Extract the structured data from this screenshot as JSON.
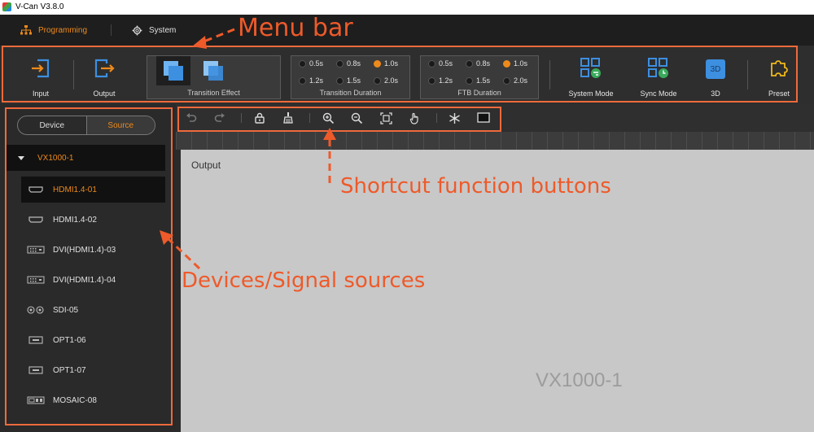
{
  "window": {
    "title": "V-Can V3.8.0"
  },
  "tabs": [
    {
      "label": "Programming",
      "icon": "sitemap-icon"
    },
    {
      "label": "System",
      "icon": "gear-icon"
    }
  ],
  "ribbon": {
    "input_label": "Input",
    "output_label": "Output",
    "transition_effect": {
      "label": "Transition Effect"
    },
    "transition_duration": {
      "label": "Transition Duration",
      "options": [
        "0.5s",
        "0.8s",
        "1.0s",
        "1.2s",
        "1.5s",
        "2.0s"
      ],
      "selected": "1.0s"
    },
    "ftb_duration": {
      "label": "FTB Duration",
      "options": [
        "0.5s",
        "0.8s",
        "1.0s",
        "1.2s",
        "1.5s",
        "2.0s"
      ],
      "selected": "1.0s"
    },
    "system_mode_label": "System Mode",
    "sync_mode_label": "Sync Mode",
    "threed_label": "3D",
    "threed_icon_text": "3D",
    "preset_label": "Preset"
  },
  "sidebar": {
    "segment": {
      "device": "Device",
      "source": "Source",
      "selected": "Source"
    },
    "device_name": "VX1000-1",
    "sources": [
      {
        "label": "HDMI1.4-01",
        "icon": "hdmi-port-icon",
        "selected": true
      },
      {
        "label": "HDMI1.4-02",
        "icon": "hdmi-port-icon",
        "selected": false
      },
      {
        "label": "DVI(HDMI1.4)-03",
        "icon": "dvi-port-icon",
        "selected": false
      },
      {
        "label": "DVI(HDMI1.4)-04",
        "icon": "dvi-port-icon",
        "selected": false
      },
      {
        "label": "SDI-05",
        "icon": "sdi-port-icon",
        "selected": false
      },
      {
        "label": "OPT1-06",
        "icon": "optical-port-icon",
        "selected": false
      },
      {
        "label": "OPT1-07",
        "icon": "optical-port-icon",
        "selected": false
      },
      {
        "label": "MOSAIC-08",
        "icon": "mosaic-icon",
        "selected": false
      }
    ]
  },
  "workspace": {
    "output_label": "Output",
    "device_label": "VX1000-1"
  },
  "annotations": {
    "menu_bar": "Menu bar",
    "shortcut_buttons": "Shortcut function buttons",
    "devices_sources": "Devices/Signal sources"
  },
  "colors": {
    "accent": "#ee8a1b",
    "annotation": "#ee5a2a",
    "icon_blue": "#3d8fe0"
  }
}
